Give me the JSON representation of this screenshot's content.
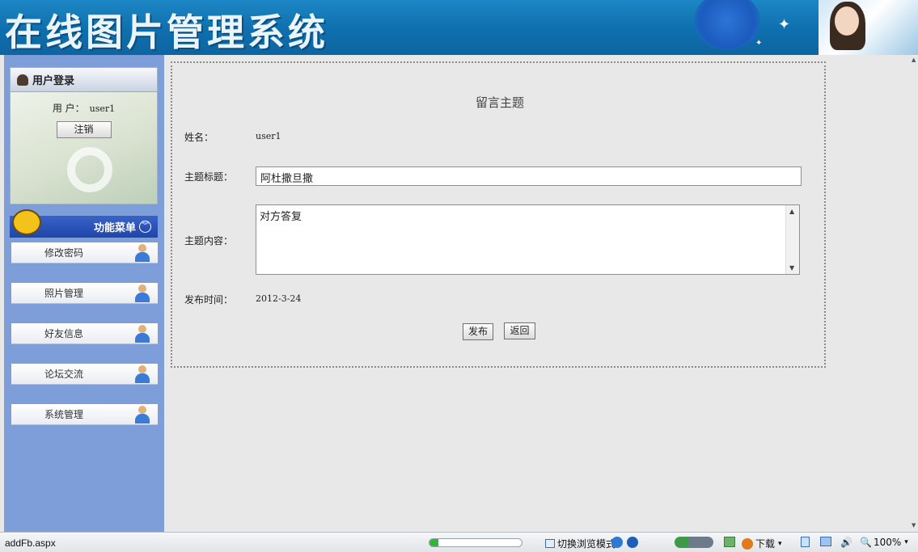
{
  "banner": {
    "title": "在线图片管理系统"
  },
  "sidebar": {
    "login": {
      "header": "用户登录",
      "user_label": "用 户：",
      "user_value": "user1",
      "logout_label": "注销"
    },
    "menu": {
      "header": "功能菜单",
      "items": [
        {
          "label": "修改密码"
        },
        {
          "label": "照片管理"
        },
        {
          "label": "好友信息"
        },
        {
          "label": "论坛交流"
        },
        {
          "label": "系统管理"
        }
      ]
    }
  },
  "form": {
    "title": "留言主题",
    "name_label": "姓名：",
    "name_value": "user1",
    "subject_label": "主题标题：",
    "subject_value": "阿杜撒旦撒",
    "content_label": "主题内容：",
    "content_value": "对方答复",
    "time_label": "发布时间：",
    "time_value": "2012-3-24",
    "publish_label": "发布",
    "back_label": "返回"
  },
  "statusbar": {
    "url": "addFb.aspx",
    "progress": 0.1,
    "browse_mode_label": "切换浏览模式",
    "download_label": "下载",
    "zoom": "100%"
  },
  "colors": {
    "banner_blue": "#0f6fae",
    "sidebar_blue": "#7d9ed9",
    "menu_header_blue": "#1f45a8",
    "progress_green": "#2fb53a"
  }
}
